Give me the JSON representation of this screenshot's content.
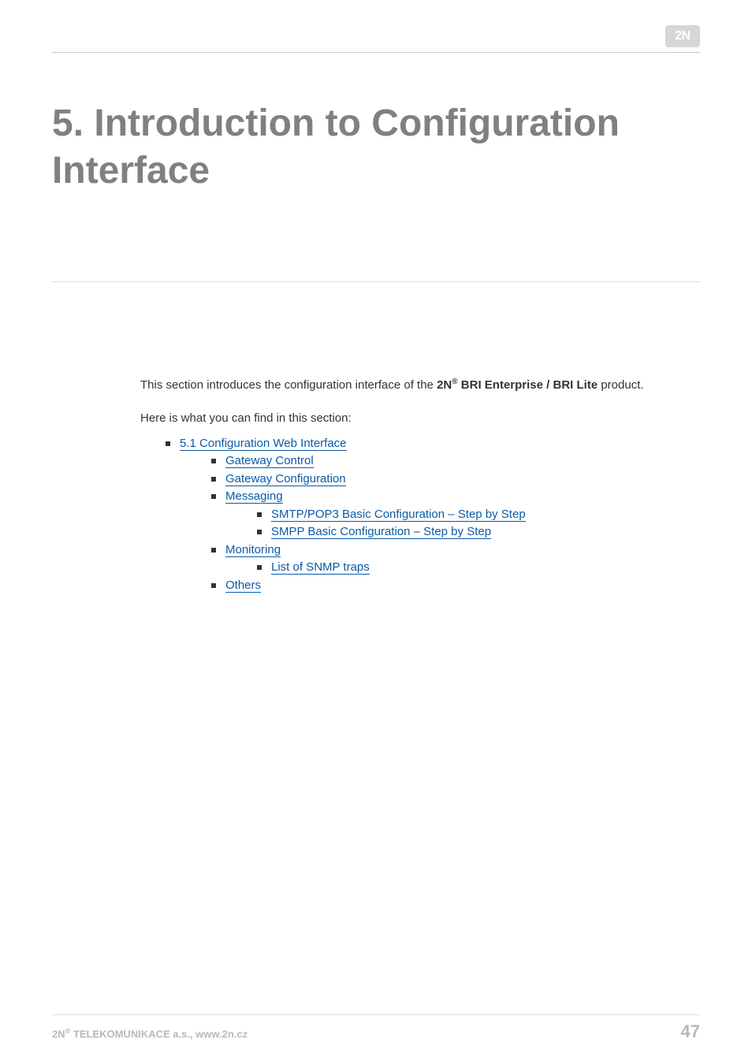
{
  "logo_text": "2N",
  "title": "5. Introduction to Configuration Interface",
  "intro_prefix": "This section introduces the configuration interface of the ",
  "intro_bold_brand": "2N",
  "intro_bold_reg": "®",
  "intro_bold_rest": " BRI Enterprise / BRI Lite",
  "intro_suffix": " product.",
  "section_hint": "Here is what you can find in this section:",
  "toc": {
    "l1": "5.1 Configuration Web Interface",
    "l2a": "Gateway Control",
    "l2b": "Gateway Configuration",
    "l2c": "Messaging",
    "l3a": "SMTP/POP3 Basic Configuration – Step by Step",
    "l3b": "SMPP Basic Configuration – Step by Step",
    "l2d": "Monitoring",
    "l3c": "List of SNMP traps",
    "l2e": "Others"
  },
  "footer": {
    "company_prefix": "2N",
    "company_reg": "®",
    "company_rest": " TELEKOMUNIKACE a.s., www.2n.cz",
    "page_number": "47"
  }
}
